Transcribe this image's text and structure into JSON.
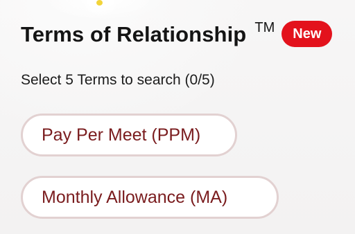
{
  "section": {
    "title": "Terms of Relationship",
    "trademark": "TM",
    "badge": "New",
    "instruction": "Select 5 Terms to search (0/5)"
  },
  "terms": [
    {
      "label": "Pay Per Meet (PPM)"
    },
    {
      "label": "Monthly Allowance (MA)"
    }
  ],
  "colors": {
    "badge_bg": "#e3121c",
    "chip_text": "#7a1c1e",
    "chip_border": "#e2d1d1"
  }
}
